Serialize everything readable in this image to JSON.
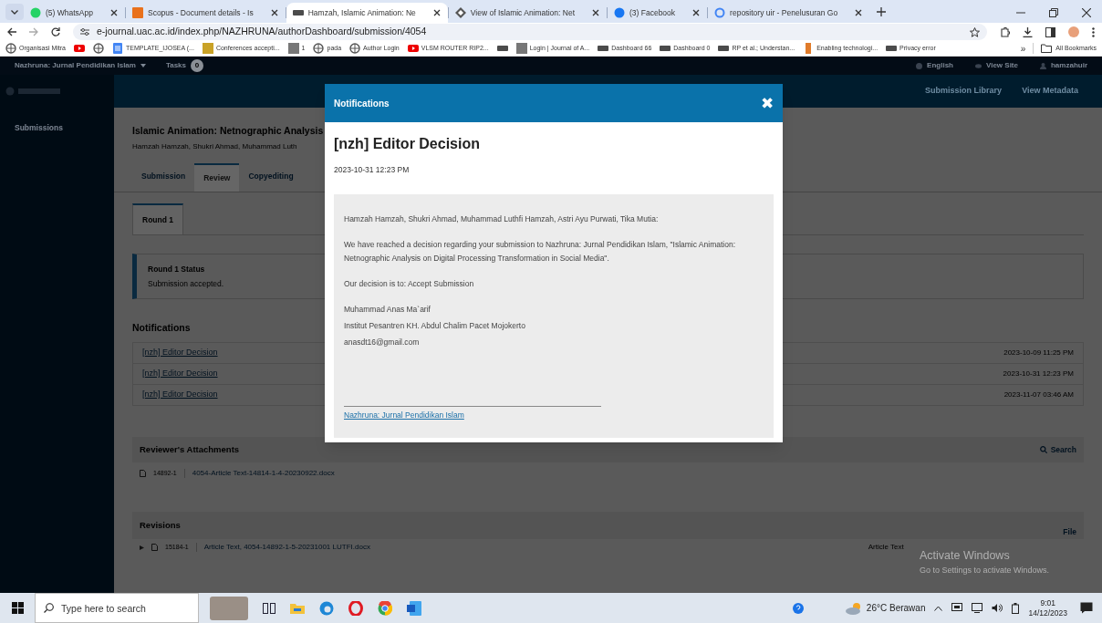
{
  "browser": {
    "tabs": [
      {
        "title": "(5) WhatsApp",
        "kind": "chat",
        "selected": false
      },
      {
        "title": "Scopus - Document details - Is",
        "kind": "square",
        "selected": false
      },
      {
        "title": "Hamzah, Islamic Animation: Ne",
        "kind": "pkp",
        "selected": true
      },
      {
        "title": "View of Islamic Animation: Net",
        "kind": "diamond",
        "selected": false
      },
      {
        "title": "(3) Facebook",
        "kind": "circle",
        "selected": false
      },
      {
        "title": "repository uir - Penelusuran Go",
        "kind": "search",
        "selected": false
      }
    ],
    "address": "e-journal.uac.ac.id/index.php/NAZHRUNA/authorDashboard/submission/4054",
    "bookmarks": [
      {
        "label": "Organisasi Mitra",
        "kind": "globe"
      },
      {
        "kind": "video"
      },
      {
        "kind": "globe"
      },
      {
        "label": "TEMPLATE_IJOSEA (...",
        "kind": "doc"
      },
      {
        "label": "Conferences accepti...",
        "kind": "award"
      },
      {
        "label": "1",
        "kind": "tile"
      },
      {
        "label": "pada",
        "kind": "globe"
      },
      {
        "label": "Author Login",
        "kind": "globe"
      },
      {
        "label": "VLSM ROUTER RIP2...",
        "kind": "video"
      },
      {
        "kind": "pkp"
      },
      {
        "label": "Login | Journal of A...",
        "kind": "tile"
      },
      {
        "label": "Dashboard 66",
        "kind": "pkp"
      },
      {
        "label": "Dashboard 0",
        "kind": "pkp"
      },
      {
        "label": "RP et al.; Understan...",
        "kind": "pkp"
      },
      {
        "label": "Enabling technologi...",
        "kind": "letter"
      },
      {
        "label": "Privacy error",
        "kind": "pkp"
      }
    ],
    "more": "»",
    "all_bookmarks": "All Bookmarks"
  },
  "app": {
    "journal": "Nazhruna: Jurnal Pendidikan Islam",
    "tasks_label": "Tasks",
    "tasks_count": "0",
    "language": "English",
    "view_site": "View Site",
    "user": "hamzahuir",
    "header_actions": [
      "Submission Library",
      "View Metadata"
    ],
    "sidebar": [
      {
        "label": "Submissions",
        "selected": true
      }
    ],
    "submission_title": "Islamic Animation: Netnographic Analysis",
    "authors": "Hamzah Hamzah, Shukri Ahmad, Muhammad Luth",
    "stage_tabs": [
      {
        "label": "Submission",
        "selected": false
      },
      {
        "label": "Review",
        "selected": true
      },
      {
        "label": "Copyediting",
        "selected": false
      }
    ],
    "round_tabs": [
      {
        "label": "Round 1",
        "selected": true
      }
    ],
    "status": {
      "title": "Round 1 Status",
      "text": "Submission accepted."
    },
    "notifications": {
      "heading": "Notifications",
      "rows": [
        {
          "title": "[nzh] Editor Decision",
          "date": "2023-10-09 11:25 PM"
        },
        {
          "title": "[nzh] Editor Decision",
          "date": "2023-10-31 12:23 PM"
        },
        {
          "title": "[nzh] Editor Decision",
          "date": "2023-11-07 03:46 AM"
        }
      ]
    },
    "attachments": {
      "heading": "Reviewer's Attachments",
      "search": "Search",
      "files": [
        {
          "id": "14892-1",
          "name": "4054-Article Text-14814-1-4-20230922.docx"
        }
      ]
    },
    "revisions": {
      "heading": "Revisions",
      "action": "File",
      "files": [
        {
          "id": "15184-1",
          "name": "Article Text, 4054-14892-1-5-20231001 LUTFI.docx",
          "type": "Article Text"
        }
      ]
    }
  },
  "modal": {
    "title": "Notifications",
    "close": "✖",
    "subject": "[nzh] Editor Decision",
    "date": "2023-10-31 12:23 PM",
    "paragraphs": [
      [
        "Hamzah Hamzah, Shukri Ahmad, Muhammad Luthfi Hamzah, Astri Ayu Purwati, Tika Mutia:"
      ],
      [
        "We have reached a decision regarding your submission to Nazhruna: Jurnal Pendidikan Islam, \"Islamic Animation: Netnographic Analysis on Digital Processing Transformation in Social Media\"."
      ],
      [
        "Our decision is to: Accept Submission"
      ],
      [
        "Muhammad Anas Ma`arif",
        "Institut Pesantren KH. Abdul Chalim Pacet Mojokerto",
        "anasdt16@gmail.com"
      ]
    ],
    "footer_link": "Nazhruna: Jurnal Pendidikan Islam"
  },
  "os_notice": {
    "title": "Activate Windows",
    "text": "Go to Settings to activate Windows."
  },
  "taskbar": {
    "search_placeholder": "Type here to search",
    "weather": "26°C Berawan",
    "time": "9:01",
    "date": "14/12/2023"
  }
}
